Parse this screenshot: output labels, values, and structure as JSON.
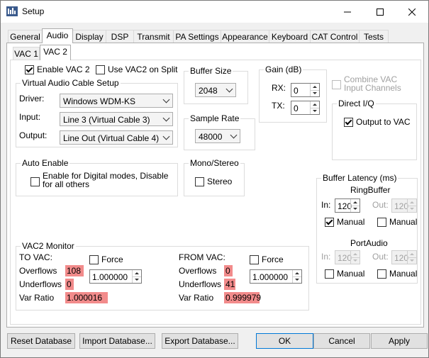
{
  "window": {
    "title": "Setup"
  },
  "tabs": [
    "General",
    "Audio",
    "Display",
    "DSP",
    "Transmit",
    "PA Settings",
    "Appearance",
    "Keyboard",
    "CAT Control",
    "Tests"
  ],
  "subtabs": [
    "VAC 1",
    "VAC 2"
  ],
  "enable_vac2": "Enable VAC 2",
  "use_vac2_on_split": "Use VAC2 on Split",
  "vac_setup": {
    "legend": "Virtual Audio Cable Setup",
    "driver_label": "Driver:",
    "driver_value": "Windows WDM-KS",
    "input_label": "Input:",
    "input_value": "Line 3 (Virtual Cable 3)",
    "output_label": "Output:",
    "output_value": "Line Out (Virtual Cable 4)"
  },
  "buffer_size": {
    "legend": "Buffer Size",
    "value": "2048"
  },
  "sample_rate": {
    "legend": "Sample Rate",
    "value": "48000"
  },
  "gain": {
    "legend": "Gain (dB)",
    "rx_label": "RX:",
    "rx_value": "0",
    "tx_label": "TX:",
    "tx_value": "0"
  },
  "combine_vac": "Combine VAC\nInput Channels",
  "direct_iq": {
    "legend": "Direct I/Q",
    "output_to_vac": "Output to VAC"
  },
  "auto_enable": {
    "legend": "Auto Enable",
    "label": "Enable for Digital modes, Disable\nfor all others"
  },
  "mono_stereo": {
    "legend": "Mono/Stereo",
    "label": "Stereo"
  },
  "buffer_latency": {
    "legend": "Buffer Latency (ms)",
    "ringbuffer": {
      "title": "RingBuffer",
      "in_label": "In:",
      "in_value": "120",
      "out_label": "Out:",
      "out_value": "120",
      "manual": "Manual"
    },
    "portaudio": {
      "title": "PortAudio",
      "in_label": "In:",
      "in_value": "120",
      "out_label": "Out:",
      "out_value": "120",
      "manual": "Manual"
    }
  },
  "monitor": {
    "legend": "VAC2 Monitor",
    "to_vac": {
      "heading": "TO VAC:",
      "force": "Force",
      "overflows_label": "Overflows",
      "overflows": "108",
      "underflows_label": "Underflows",
      "underflows": "0",
      "var_ratio_label": "Var Ratio",
      "var_ratio": "1.000016",
      "spin": "1.000000"
    },
    "from_vac": {
      "heading": "FROM VAC:",
      "force": "Force",
      "overflows_label": "Overflows",
      "overflows": "0",
      "underflows_label": "Underflows",
      "underflows": "41",
      "var_ratio_label": "Var Ratio",
      "var_ratio": "0.999979",
      "spin": "1.000000"
    }
  },
  "buttons": {
    "reset": "Reset Database",
    "import": "Import Database...",
    "export": "Export Database...",
    "ok": "OK",
    "cancel": "Cancel",
    "apply": "Apply"
  },
  "colors": {
    "highlight": "#f28b8b"
  }
}
